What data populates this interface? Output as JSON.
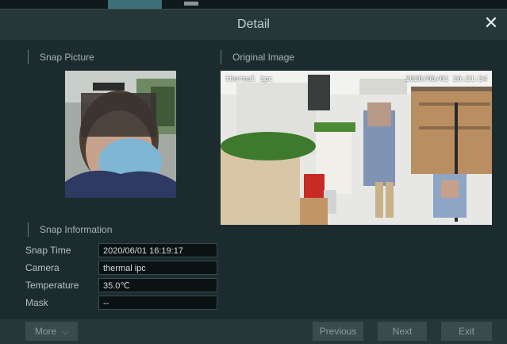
{
  "dialog": {
    "title": "Detail",
    "close_icon": "close-icon"
  },
  "sections": {
    "snap_picture": "Snap Picture",
    "original_image": "Original Image",
    "snap_information": "Snap Information"
  },
  "original_image": {
    "overlay_channel": "thermal ipc",
    "overlay_timestamp": "2020/06/01 16:21:34"
  },
  "info": [
    {
      "label": "Snap Time",
      "value": "2020/06/01 16:19:17"
    },
    {
      "label": "Camera",
      "value": "thermal ipc"
    },
    {
      "label": "Temperature",
      "value": "35.0℃"
    },
    {
      "label": "Mask",
      "value": "--"
    }
  ],
  "buttons": {
    "more": "More",
    "previous": "Previous",
    "next": "Next",
    "exit": "Exit"
  },
  "colors": {
    "accent_tab": "#3d6f78",
    "titlebar": "#253739",
    "background": "#1c2c2e"
  }
}
